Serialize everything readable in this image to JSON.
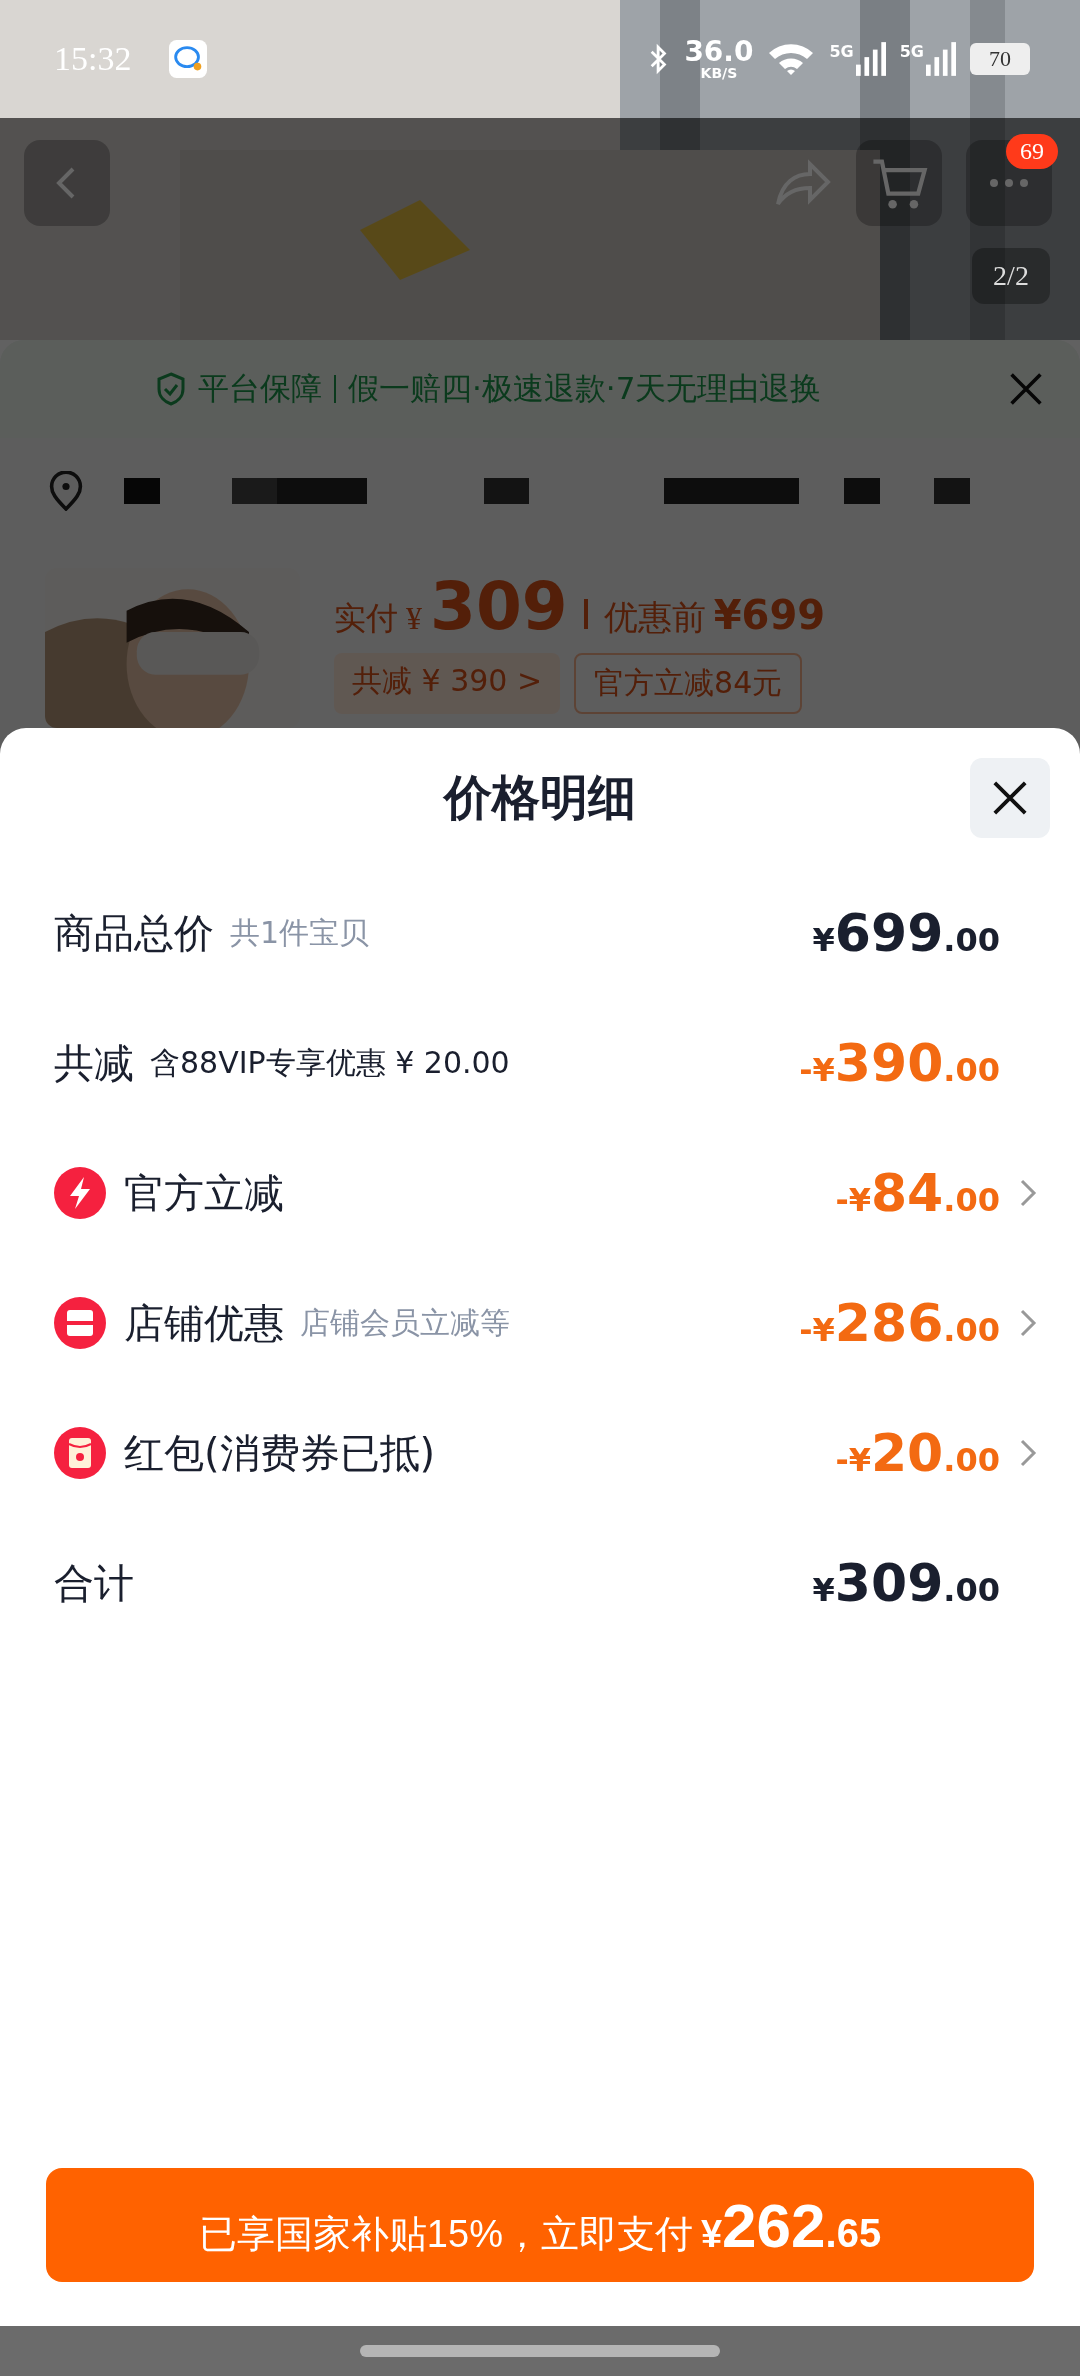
{
  "status_bar": {
    "time": "15:32",
    "net_speed": "36.0",
    "net_unit": "KB/S",
    "signals": [
      "5G",
      "5G"
    ],
    "battery": "70"
  },
  "product_header": {
    "more_badge": "69",
    "image_counter": "2/2"
  },
  "guarantee": {
    "label": "平台保障",
    "text": "假一赔四·极速退款·7天无理由退换"
  },
  "product": {
    "paid_label": "实付",
    "paid_currency": "¥",
    "paid_amount": "309",
    "original_label": "优惠前",
    "original_price": "¥699",
    "chips": [
      "共减 ¥ 390 >",
      "官方立减84元"
    ]
  },
  "sheet": {
    "title": "价格明细",
    "rows": [
      {
        "kind": "plain",
        "label": "商品总价",
        "note": "共1件宝贝",
        "currency": "¥",
        "whole": "699",
        "cents": ".00",
        "has_detail": false
      },
      {
        "kind": "plain",
        "label": "共减",
        "note": "含88VIP专享优惠 ¥ 20.00",
        "sign": "-",
        "currency": "¥",
        "whole": "390",
        "cents": ".00",
        "has_detail": false
      },
      {
        "kind": "lightning",
        "label": "官方立减",
        "sign": "-",
        "currency": "¥",
        "whole": "84",
        "cents": ".00",
        "has_detail": true
      },
      {
        "kind": "shop",
        "label": "店铺优惠",
        "note": "店铺会员立减等",
        "sign": "-",
        "currency": "¥",
        "whole": "286",
        "cents": ".00",
        "has_detail": true
      },
      {
        "kind": "envelope",
        "label": "红包(消费券已抵)",
        "sign": "-",
        "currency": "¥",
        "whole": "20",
        "cents": ".00",
        "has_detail": true
      },
      {
        "kind": "plain",
        "label": "合计",
        "currency": "¥",
        "whole": "309",
        "cents": ".00",
        "has_detail": false
      }
    ],
    "pay_button": {
      "text": "已享国家补贴15%，立即支付",
      "currency": "¥",
      "whole": "262",
      "cents": ".65"
    }
  }
}
